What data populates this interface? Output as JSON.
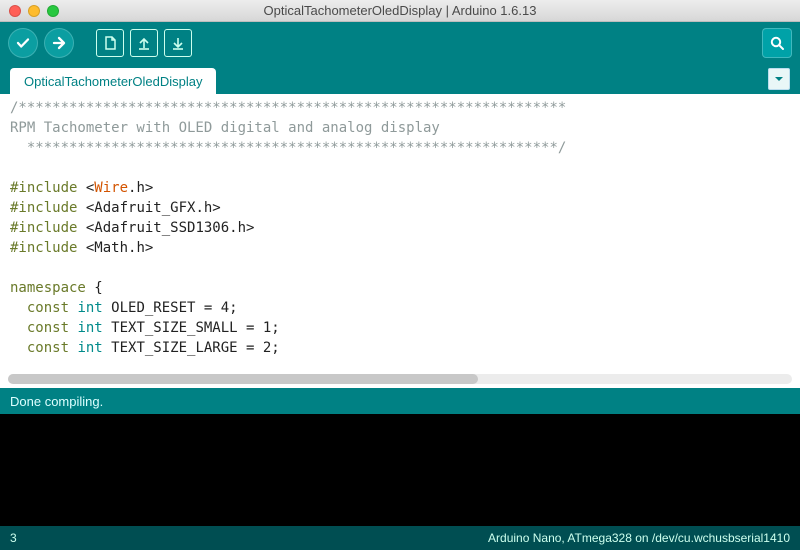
{
  "window": {
    "title": "OpticalTachometerOledDisplay | Arduino 1.6.13"
  },
  "tabs": {
    "main": "OpticalTachometerOledDisplay"
  },
  "status": {
    "message": "Done compiling."
  },
  "footer": {
    "line": "3",
    "board": "Arduino Nano, ATmega328 on /dev/cu.wchusbserial1410"
  },
  "code": {
    "l1": "/*****************************************************************",
    "l2": "RPM Tachometer with OLED digital and analog display",
    "l3": "  ***************************************************************/",
    "l4": "",
    "l5a": "#include",
    "l5b": " <",
    "l5c": "Wire",
    "l5d": ".h>",
    "l6a": "#include",
    "l6b": " <Adafruit_GFX.h>",
    "l7a": "#include",
    "l7b": " <Adafruit_SSD1306.h>",
    "l8a": "#include",
    "l8b": " <Math.h>",
    "l9": "",
    "l10a": "namespace",
    "l10b": " {",
    "l11a": "  const",
    "l11b": " int",
    "l11c": " OLED_RESET = 4;",
    "l12a": "  const",
    "l12b": " int",
    "l12c": " TEXT_SIZE_SMALL = 1;",
    "l13a": "  const",
    "l13b": " int",
    "l13c": " TEXT_SIZE_LARGE = 2;"
  }
}
